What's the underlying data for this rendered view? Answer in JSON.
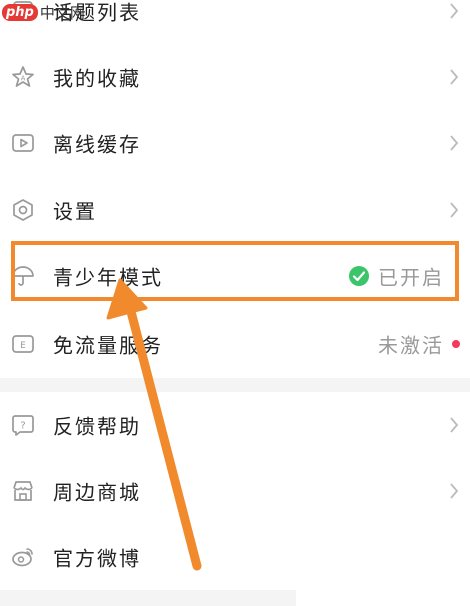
{
  "watermark": {
    "logo": "php",
    "text": "中文网"
  },
  "menu": {
    "items": [
      {
        "label": "话题列表",
        "icon": "topic-list-icon"
      },
      {
        "label": "我的收藏",
        "icon": "favorites-star-icon"
      },
      {
        "label": "离线缓存",
        "icon": "offline-cache-play-icon"
      },
      {
        "label": "设置",
        "icon": "settings-hexagon-icon"
      },
      {
        "label": "青少年模式",
        "icon": "umbrella-icon",
        "status": "已开启"
      },
      {
        "label": "免流量服务",
        "icon": "data-free-icon",
        "status": "未激活"
      },
      {
        "label": "反馈帮助",
        "icon": "feedback-help-icon"
      },
      {
        "label": "周边商城",
        "icon": "shop-icon"
      },
      {
        "label": "官方微博",
        "icon": "weibo-icon"
      }
    ]
  },
  "colors": {
    "highlight": "#f08a2c",
    "arrow": "#f08a2c",
    "check": "#3cc46b",
    "unread_dot": "#f23b5a",
    "icon_stroke": "#999999"
  }
}
